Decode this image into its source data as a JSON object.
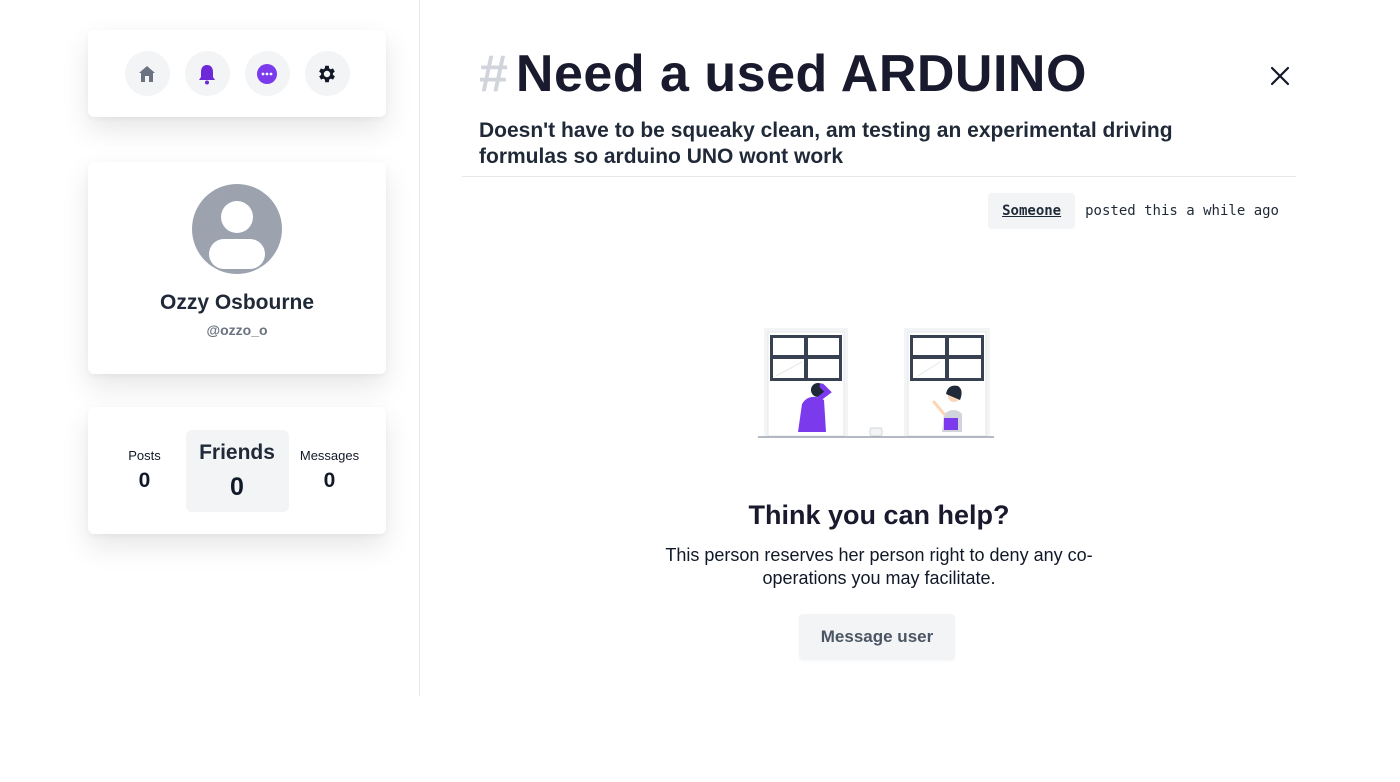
{
  "nav": {
    "items": [
      {
        "icon": "home-icon",
        "color": "#6b7280"
      },
      {
        "icon": "bell-icon",
        "color": "#6d28d9"
      },
      {
        "icon": "chat-icon",
        "color": "#7c3aed"
      },
      {
        "icon": "gear-icon",
        "color": "#111827"
      }
    ]
  },
  "profile": {
    "name": "Ozzy Osbourne",
    "handle": "@ozzo_o"
  },
  "stats": {
    "posts": {
      "label": "Posts",
      "value": "0"
    },
    "friends": {
      "label": "Friends",
      "value": "0"
    },
    "messages": {
      "label": "Messages",
      "value": "0"
    }
  },
  "post": {
    "hash": "#",
    "title": "Need a used ARDUINO",
    "subtitle": "Doesn't have to be squeaky clean, am testing an experimental driving formulas so arduino UNO wont work",
    "author": "Someone",
    "posted_text": "posted this a while ago"
  },
  "help": {
    "title": "Think you can help?",
    "text": "This person reserves her person right to deny any co-operations you may facilitate.",
    "button": "Message user"
  },
  "colors": {
    "accent": "#7c3aed",
    "muted_bg": "#f3f4f6"
  }
}
